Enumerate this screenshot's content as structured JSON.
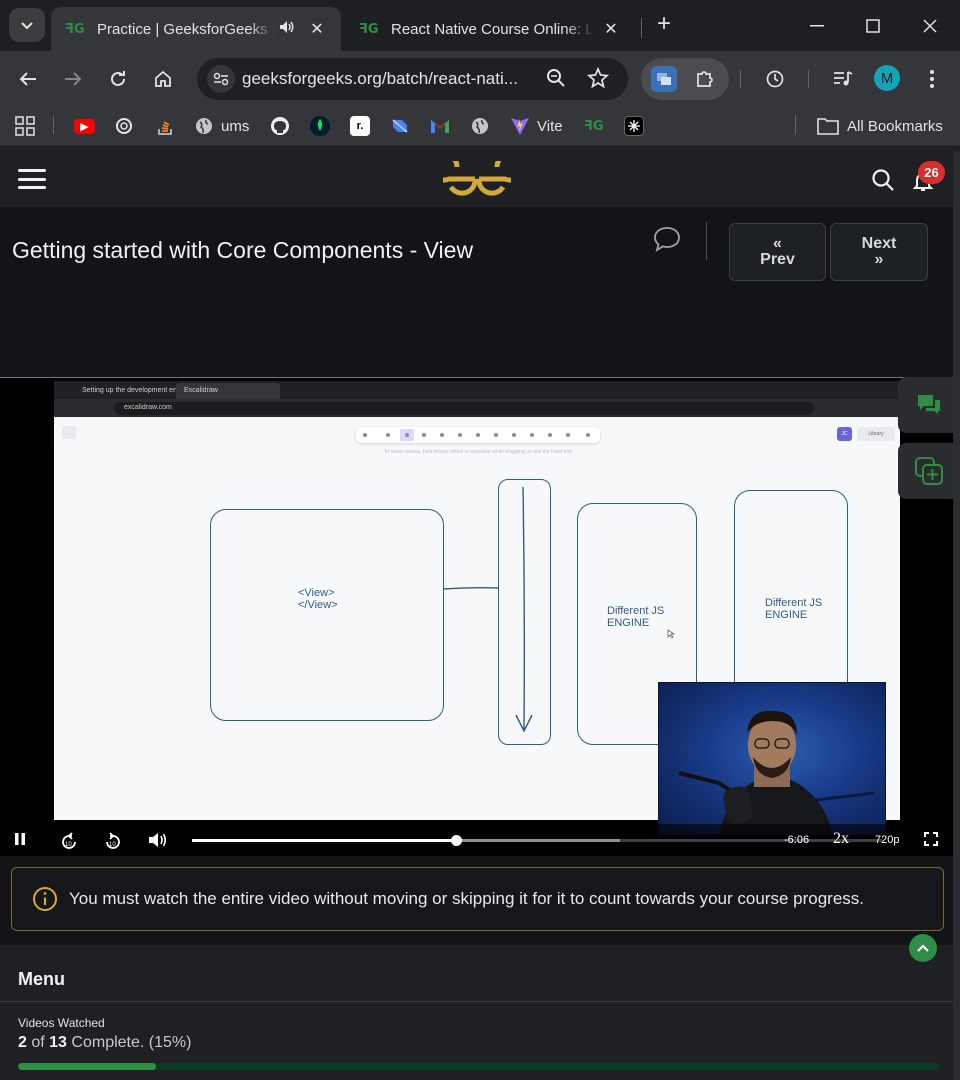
{
  "browser": {
    "tabs": [
      {
        "title": "Practice | GeeksforGeeks | A",
        "favicon": "gfg-icon",
        "active": true,
        "playing_audio": true
      },
      {
        "title": "React Native Course Online: Lea",
        "favicon": "gfg-icon",
        "active": false
      }
    ],
    "address": {
      "url": "geeksforgeeks.org/batch/react-nati..."
    },
    "bookmarks": [
      {
        "label": "",
        "icon": "apps-icon"
      },
      {
        "label": "",
        "icon": "youtube-icon",
        "color": "#ff0000"
      },
      {
        "label": "",
        "icon": "chatgpt-icon"
      },
      {
        "label": "",
        "icon": "stackoverflow-icon"
      },
      {
        "label": "ums",
        "icon": "globe-icon"
      },
      {
        "label": "",
        "icon": "github-icon"
      },
      {
        "label": "",
        "icon": "mongodb-icon"
      },
      {
        "label": "",
        "icon": "replit-icon"
      },
      {
        "label": "",
        "icon": "dart-icon"
      },
      {
        "label": "",
        "icon": "gmail-icon"
      },
      {
        "label": "",
        "icon": "globe-icon"
      },
      {
        "label": "Vite",
        "icon": "vite-icon"
      },
      {
        "label": "",
        "icon": "gfg-icon"
      },
      {
        "label": "",
        "icon": "app-icon"
      }
    ],
    "all_bookmarks_label": "All Bookmarks",
    "profile_initial": "M"
  },
  "header": {
    "notification_count": "26"
  },
  "lesson": {
    "title": "Getting started with Core Components - View",
    "prev_label": "Prev",
    "next_label": "Next"
  },
  "video": {
    "inner_tabs": [
      "Setting up the development en",
      "Excalidraw"
    ],
    "inner_url": "excalidraw.com",
    "canvas_hint": "To move canvas, hold mouse wheel or spacebar while dragging, or use the hand tool",
    "library_label": "Library",
    "canvas_texts": {
      "view_box": [
        "<View>",
        "</View>"
      ],
      "engine_1": [
        "Different JS",
        "ENGINE"
      ],
      "engine_2": [
        "Different JS",
        "ENGINE"
      ]
    },
    "time_remaining": "-6:06",
    "playback_speed": "2x",
    "quality": "720p",
    "progress_played": 0.383,
    "progress_buffered": 0.62
  },
  "notice": {
    "text": "You must watch the entire video without moving or skipping it for it to count towards your course progress."
  },
  "menu": {
    "title": "Menu",
    "videos_watched_label": "Videos Watched",
    "watched": "2",
    "total": "13",
    "of_word": "of",
    "complete_text": "Complete. (15%)",
    "progress_fraction": 0.15
  },
  "colors": {
    "gfg_green": "#2f8d46",
    "badge_red": "#d92d2d",
    "notice_border": "#7d6a2a",
    "logo_gold": "#d4a93a"
  }
}
